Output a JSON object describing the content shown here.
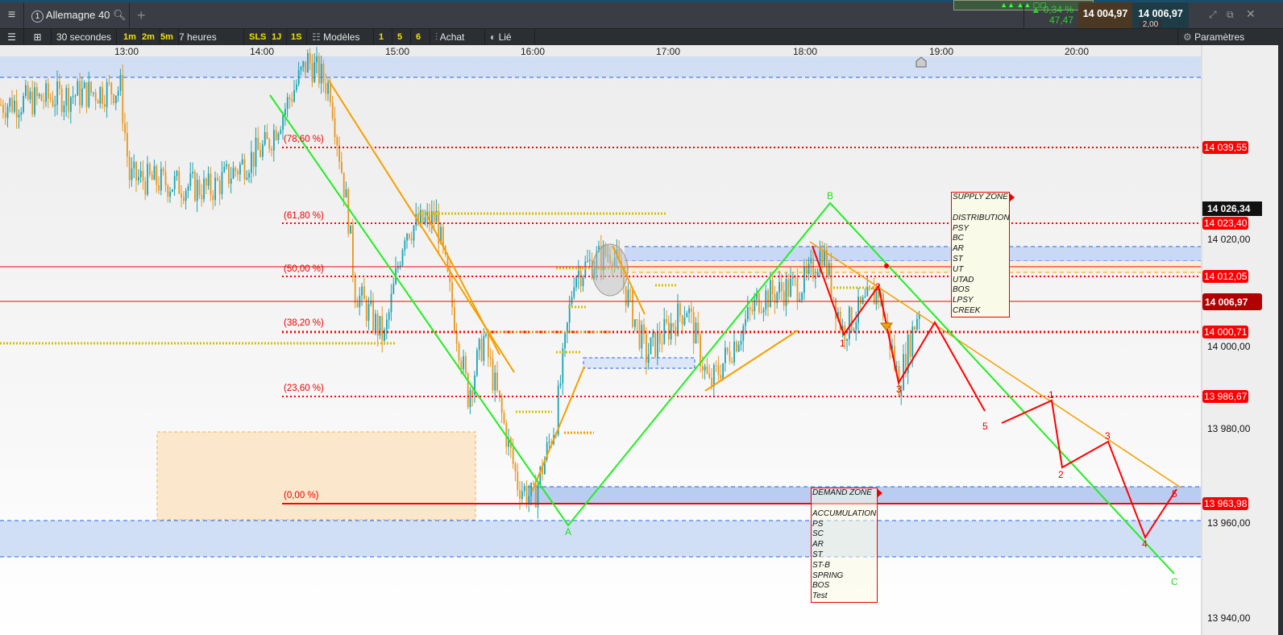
{
  "header": {
    "menu_icon": "hamburger-icon",
    "instrument_number": "1",
    "instrument": "Allemagne 40",
    "change_pct": "0,34 %",
    "change_abs": "47,47",
    "bid": "14 004,97",
    "ask": "14 006,97",
    "spread": "2,00"
  },
  "toolbar": {
    "interval": "30 secondes",
    "quick_intervals": [
      "1m",
      "2m",
      "5m"
    ],
    "range": "7 heures",
    "presets": [
      "SLS",
      "1J",
      "1S"
    ],
    "models": "Modèles",
    "model_slots": [
      "1",
      "5",
      "6"
    ],
    "buy": "Achat",
    "linked": "Lié",
    "settings": "Paramètres"
  },
  "colors": {
    "up": "#1aa3b5",
    "down": "#e8961e",
    "fib": "#ff0000",
    "wave_abc": "#22ee22",
    "zone_fill": "#c9d9f5"
  },
  "chart_data": {
    "type": "candlestick",
    "interval": "30 secondes",
    "x_ticks": [
      "13:00",
      "14:00",
      "15:00",
      "16:00",
      "17:00",
      "18:00",
      "19:00",
      "20:00"
    ],
    "y_ticks": [
      "14 020,00",
      "14 000,00",
      "13 980,00",
      "13 960,00",
      "13 940,00"
    ],
    "ylim": [
      13938,
      14070
    ],
    "price_path": [
      [
        "12:04",
        14048.3
      ],
      [
        "12:57",
        14051.7
      ],
      [
        "13:01",
        14032.9
      ],
      [
        "13:37",
        14030.4
      ],
      [
        "14:02",
        14039.7
      ],
      [
        "14:20",
        14057.6
      ],
      [
        "14:30",
        14051.7
      ],
      [
        "14:38",
        14024.4
      ],
      [
        "14:41",
        14009.1
      ],
      [
        "14:54",
        13998.9
      ],
      [
        "15:03",
        14021.9
      ],
      [
        "15:17",
        14024.4
      ],
      [
        "15:31",
        13987.0
      ],
      [
        "15:38",
        13998.9
      ],
      [
        "15:53",
        13968.3
      ],
      [
        "16:00",
        13964.9
      ],
      [
        "16:10",
        13981.9
      ],
      [
        "16:18",
        14012.5
      ],
      [
        "16:35",
        14017.6
      ],
      [
        "16:50",
        13995.5
      ],
      [
        "17:08",
        14005.7
      ],
      [
        "17:18",
        13988.7
      ],
      [
        "17:40",
        14007.4
      ],
      [
        "18:01",
        14010.8
      ],
      [
        "18:08",
        14017.6
      ],
      [
        "18:17",
        14000.6
      ],
      [
        "18:33",
        14009.1
      ],
      [
        "18:42",
        13989.5
      ],
      [
        "18:51",
        14005.7
      ]
    ],
    "fib_levels": [
      {
        "label": "(78,60 %)",
        "price": "14 039,55"
      },
      {
        "label": "(61,80 %)",
        "price": "14 023,40"
      },
      {
        "label": "(50,00 %)",
        "price": "14 012,05"
      },
      {
        "label": "(38,20 %)",
        "price": "14 000,71"
      },
      {
        "label": "(23,60 %)",
        "price": "13 986,67"
      },
      {
        "label": "(0,00 %)",
        "price": "13 963,98"
      }
    ],
    "last_price": "14 006,97",
    "crosshair_price": "14 026,34",
    "wave_labels_abc": [
      "A",
      "B",
      "C"
    ],
    "wave_labels_1": [
      "1",
      "2",
      "3",
      "5"
    ],
    "wave_labels_2": [
      "1",
      "2",
      "3",
      "4",
      "5"
    ],
    "supply_zone": {
      "title": "SUPPLY ZONE",
      "items": [
        "DISTRIBUTION",
        "PSY",
        "BC",
        "AR",
        "ST",
        "UT",
        "UTAD",
        "BOS",
        "LPSY",
        "CREEK"
      ]
    },
    "demand_zone": {
      "title": "DEMAND ZONE",
      "items": [
        "ACCUMULATION",
        "PS",
        "SC",
        "AR",
        "ST",
        "ST-B",
        "SPRING",
        "BOS",
        "Test"
      ]
    }
  }
}
